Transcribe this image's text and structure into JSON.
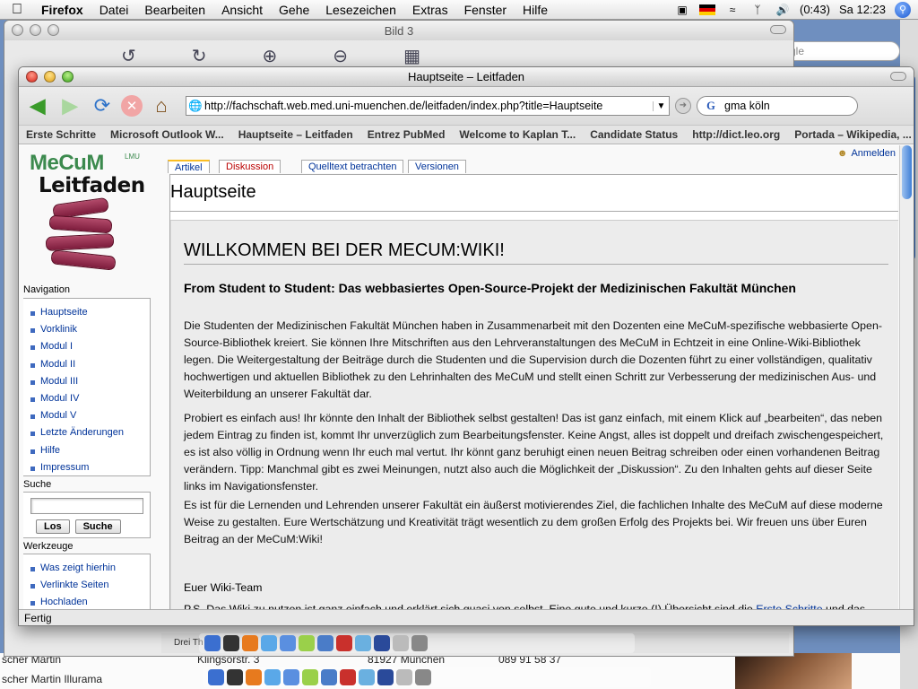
{
  "menubar": {
    "app": "Firefox",
    "menus": [
      "Datei",
      "Bearbeiten",
      "Ansicht",
      "Gehe",
      "Lesezeichen",
      "Extras",
      "Fenster",
      "Hilfe"
    ],
    "battery": "(0:43)",
    "clock": "Sa 12:23"
  },
  "bg_window": {
    "title": "Bild 3",
    "search_placeholder": "gle",
    "status_text": "Drei Th"
  },
  "bottom_strip": {
    "row1_col1": "scher Martin",
    "row1_col2": "Klingsorstr. 3",
    "row1_col3": "81927 München",
    "row1_col4": "089 91 58 37",
    "row2_col1": "scher Martin Illurama"
  },
  "firefox": {
    "title": "Hauptseite – Leitfaden",
    "url": "http://fachschaft.web.med.uni-muenchen.de/leitfaden/index.php?title=Hauptseite",
    "search_value": "gma köln",
    "search_engine": "G",
    "bookmarks": [
      "Erste Schritte",
      "Microsoft Outlook W...",
      "Hauptseite – Leitfaden",
      "Entrez PubMed",
      "Welcome to Kaplan T...",
      "Candidate Status",
      "http://dict.leo.org",
      "Portada – Wikipedia, ..."
    ],
    "status": "Fertig"
  },
  "wiki": {
    "logo_mecum": "MeCuM",
    "logo_lmu": "LMU",
    "logo_leitfaden": "Leitfaden",
    "login": "Anmelden",
    "tabs": [
      "Artikel",
      "Diskussion",
      "Quelltext betrachten",
      "Versionen"
    ],
    "page_title": "Hauptseite",
    "navigation_heading": "Navigation",
    "navigation": [
      "Hauptseite",
      "Vorklinik",
      "Modul I",
      "Modul II",
      "Modul III",
      "Modul IV",
      "Modul V",
      "Letzte Änderungen",
      "Hilfe",
      "Impressum"
    ],
    "search_heading": "Suche",
    "search_go": "Los",
    "search_button": "Suche",
    "tools_heading": "Werkzeuge",
    "tools": [
      "Was zeigt hierhin",
      "Verlinkte Seiten",
      "Hochladen"
    ],
    "welcome": "WILLKOMMEN BEI DER MECUM:WIKI!",
    "subheading": "From Student to Student: Das webbasiertes Open-Source-Projekt der Medizinischen Fakultät München",
    "paragraph1": "Die Studenten der Medizinischen Fakultät München haben in Zusammenarbeit mit den Dozenten eine MeCuM-spezifische webbasierte Open-Source-Bibliothek kreiert. Sie können Ihre Mitschriften aus den Lehrveranstaltungen des MeCuM in Echtzeit in eine Online-Wiki-Bibliothek legen. Die Weitergestaltung der Beiträge durch die Studenten und die Supervision durch die Dozenten führt zu einer vollständigen, qualitativ hochwertigen und aktuellen Bibliothek zu den Lehrinhalten des MeCuM und stellt einen Schritt zur Verbesserung der medizinischen Aus- und Weiterbildung an unserer Fakultät dar.",
    "paragraph2": "Probiert es einfach aus! Ihr könnte den Inhalt der Bibliothek selbst gestalten! Das ist ganz einfach, mit einem Klick auf „bearbeiten“, das neben jedem Eintrag zu finden ist, kommt Ihr unverzüglich zum Bearbeitungsfenster. Keine Angst, alles ist doppelt und dreifach zwischengespeichert, es ist also völlig in Ordnung wenn Ihr euch mal vertut. Ihr könnt ganz beruhigt einen neuen Beitrag schreiben oder einen vorhandenen Beitrag verändern. Tipp: Manchmal gibt es zwei Meinungen, nutzt also auch die Möglichkeit der „Diskussion“. Zu den Inhalten gehts auf dieser Seite links im Navigationsfenster.",
    "paragraph3": "Es ist für die Lernenden und Lehrenden unserer Fakultät ein äußerst motivierendes Ziel, die fachlichen Inhalte des MeCuM auf diese moderne Weise zu gestalten. Eure Wertschätzung und Kreativität trägt wesentlich zu dem großen Erfolg des Projekts bei. Wir freuen uns über Euren Beitrag an der MeCuM:Wiki!",
    "signoff": "Euer Wiki-Team",
    "ps_start": "P.S. Das Wiki zu nutzen ist ganz einfach und erklärt sich quasi von selbst. Eine gute und kurze (!) Übersicht sind die ",
    "ps_link": "Erste Schritte",
    "ps_end": " und das"
  },
  "colors": {
    "link": "#003399",
    "new_link": "#ba0000",
    "logo_green": "#3c8a4e",
    "book_red": "#9a2d50",
    "active_tab": "#fabd23"
  }
}
